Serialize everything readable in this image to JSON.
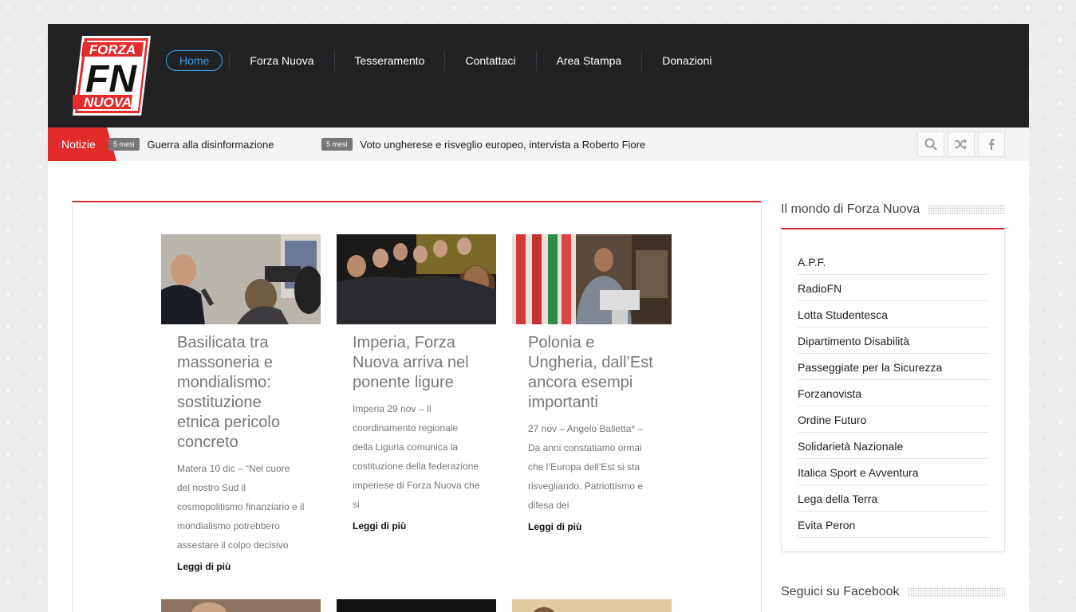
{
  "brand": {
    "logo_top": "FORZA",
    "logo_mid": "FN",
    "logo_bottom": "NUOVA",
    "colors": {
      "red": "#e22b2b",
      "dark": "#222225",
      "accent_blue": "#3ea0e0"
    }
  },
  "nav": {
    "items": [
      {
        "label": "Home",
        "active": true
      },
      {
        "label": "Forza Nuova"
      },
      {
        "label": "Tesseramento"
      },
      {
        "label": "Contattaci"
      },
      {
        "label": "Area Stampa"
      },
      {
        "label": "Donazioni"
      }
    ]
  },
  "ticker": {
    "label": "Notizie",
    "items": [
      {
        "badge": "5 mesi",
        "text": "Guerra alla disinformazione"
      },
      {
        "badge": "5 mesi",
        "text": "Voto ungherese e risveglio europeo, intervista a Roberto Fiore"
      }
    ],
    "icons": [
      "search-icon",
      "shuffle-icon",
      "facebook-icon"
    ]
  },
  "articles": [
    {
      "title": "Basilicata tra massoneria e mondialismo: sostituzione etnica pericolo concreto",
      "excerpt": "Matera 10 dic – “Nel cuore del nostro Sud il cosmopolitismo finanziario e il mondialismo potrebbero assestare il colpo decisivo",
      "more": "Leggi di più"
    },
    {
      "title": "Imperia, Forza Nuova arriva nel ponente ligure",
      "excerpt": "Imperia 29 nov – Il coordinamento regionale della Liguria comunica la costituzione della federazione imperiese di Forza Nuova che si",
      "more": "Leggi di più"
    },
    {
      "title": "Polonia e Ungheria, dall’Est ancora esempi importanti",
      "excerpt": "27 nov – Angelo Balletta* – Da anni constatiamo ormai che l’Europa dell’Est si sta risvegliando. Patriottismo e difesa dei",
      "more": "Leggi di più"
    }
  ],
  "sidebar": {
    "title": "Il mondo di Forza Nuova",
    "links": [
      "A.P.F.",
      "RadioFN",
      "Lotta Studentesca",
      "Dipartimento Disabilità",
      "Passeggiate per la Sicurezza",
      "Forzanovista",
      "Ordine Futuro",
      "Solidarietà Nazionale",
      "Italica Sport e Avventura",
      "Lega della Terra",
      "Evita Peron"
    ],
    "facebook_title": "Seguici su Facebook"
  }
}
